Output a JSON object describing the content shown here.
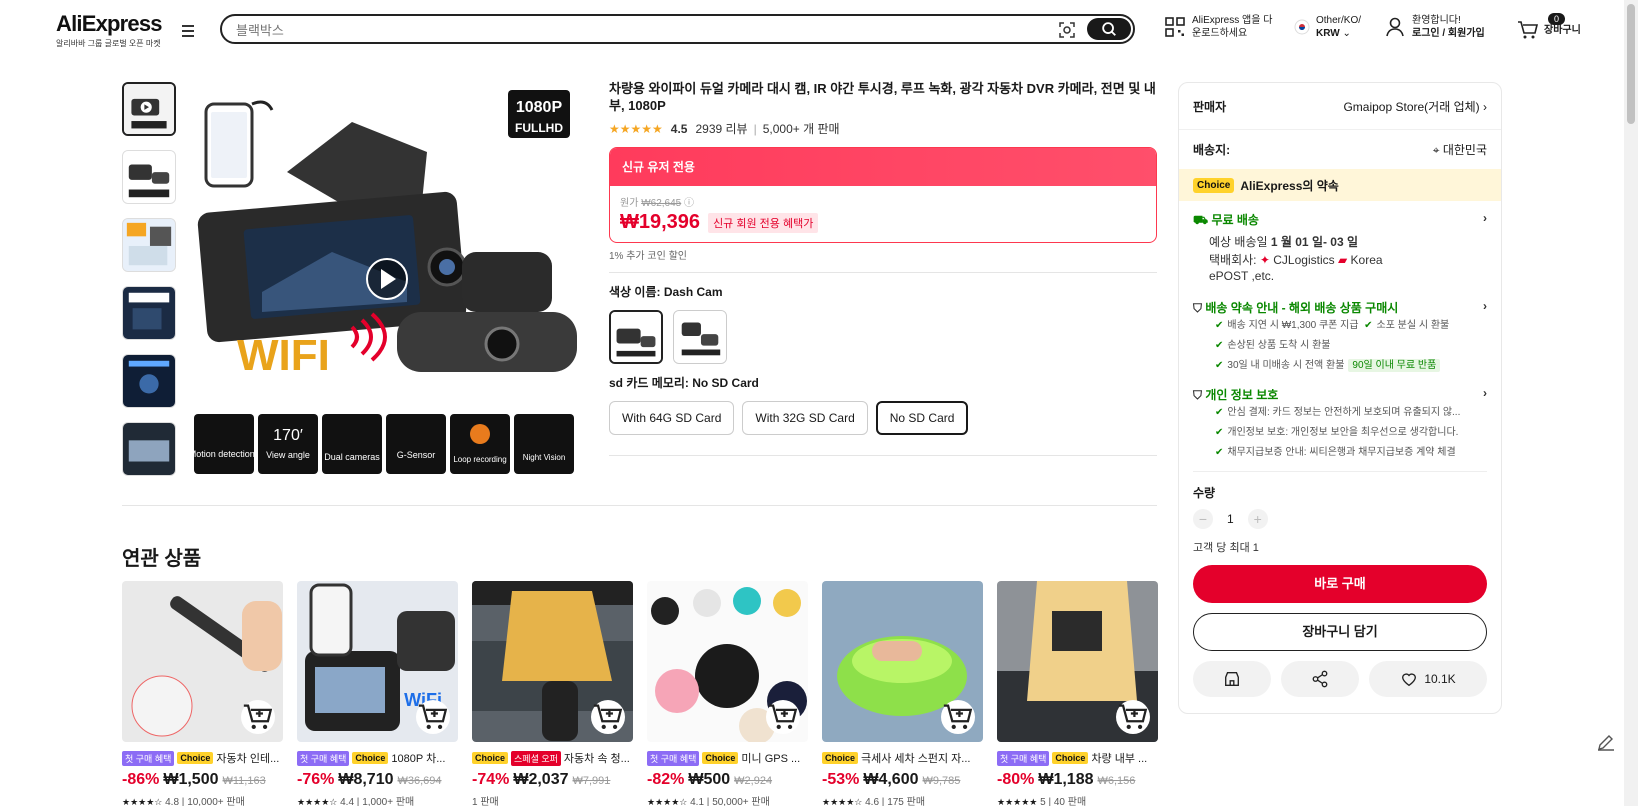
{
  "header": {
    "logo": "AliExpress",
    "logo_sub": "알리바바 그룹 글로벌 오픈 마켓",
    "search_placeholder": "블랙박스",
    "app_line1": "AliExpress 앱을 다",
    "app_line2": "운로드하세요",
    "region_line1": "Other/KO/",
    "region_line2": "KRW",
    "account_line1": "환영합니다!",
    "account_line2": "로그인 / 회원가입",
    "cart_count": "0",
    "cart_label": "장바구니"
  },
  "product": {
    "title": "차량용 와이파이 듀얼 카메라 대시 캠, IR 야간 투시경, 루프 녹화, 광각 자동차 DVR 카메라, 전면 및 내부, 1080P",
    "rating": "4.5",
    "reviews": "2939 리뷰",
    "sold": "5,000+ 개 판매",
    "promo_header": "신규 유저 전용",
    "orig_label": "원가",
    "orig_price": "₩62,645",
    "price": "₩19,396",
    "price_tag": "신규 회원 전용 혜택가",
    "coin_note": "1% 추가 코인 할인",
    "color_label": "색상 이름: Dash Cam",
    "sd_label": "sd 카드 메모리: No SD Card",
    "sd_options": [
      "With 64G SD Card",
      "With 32G SD Card",
      "No SD Card"
    ],
    "image_badge_top": "1080P",
    "image_badge_bottom": "FULLHD",
    "image_wifi": "WIFI",
    "features": [
      "Motion detections",
      "View angle",
      "Dual cameras",
      "G-Sensor",
      "Loop recording",
      "Night Vision"
    ],
    "feature_angle": "170′"
  },
  "panel": {
    "seller_label": "판매자",
    "seller_name": "Gmaipop Store(거래 업체)",
    "ship_to_label": "배송지:",
    "ship_to": "대한민국",
    "choice_chip": "Choice",
    "choice_text": "AliExpress의 약속",
    "free_ship": "무료 배송",
    "eta_prefix": "예상 배송일 ",
    "eta": "1 월 01 일- 03 일",
    "carrier_label": "택배회사: ",
    "carrier1": "CJLogistics",
    "carrier2": "Korea",
    "carrier3": "ePOST ,etc.",
    "promise_title": "배송 약속 안내 - 해외 배송 상품 구매시",
    "promise_items": [
      "배송 지연 시 ₩1,300 쿠폰 지급",
      "소포 분실 시 환불",
      "손상된 상품 도착 시 환불",
      "30일 내 미배송 시 전액 환불"
    ],
    "promise_chip": "90일 이내 무료 반품",
    "privacy_title": "개인 정보 보호",
    "privacy_items": [
      "안심 결제: 카드 정보는 안전하게 보호되며 유출되지 않...",
      "개인정보 보호: 개인정보 보안을 최우선으로 생각합니다.",
      "채무지급보증 안내: 씨티은행과 채무지급보증 계약 체결"
    ],
    "qty_label": "수량",
    "qty": "1",
    "qty_limit": "고객 당 최대 1",
    "buy_now": "바로 구매",
    "add_cart": "장바구니 담기",
    "wish_count": "10.1K"
  },
  "related": {
    "title": "연관 상품",
    "items": [
      {
        "tags": [
          "첫 구매 혜택",
          "Choice"
        ],
        "name": "자동차 인테...",
        "disc": "-86%",
        "price": "₩1,500",
        "old": "₩11,163",
        "stars": "★★★★☆",
        "rating": "4.8",
        "sold": "10,000+ 판매"
      },
      {
        "tags": [
          "첫 구매 혜택",
          "Choice"
        ],
        "name": "1080P 차...",
        "disc": "-76%",
        "price": "₩8,710",
        "old": "₩36,694",
        "stars": "★★★★☆",
        "rating": "4.4",
        "sold": "1,000+ 판매"
      },
      {
        "tags": [
          "Choice",
          "스페셜 오퍼"
        ],
        "name": "자동차 속 청...",
        "disc": "-74%",
        "price": "₩2,037",
        "old": "₩7,991",
        "stars": "",
        "rating": "",
        "sold": "1 판매"
      },
      {
        "tags": [
          "첫 구매 혜택",
          "Choice"
        ],
        "name": "미니 GPS ...",
        "disc": "-82%",
        "price": "₩500",
        "old": "₩2,924",
        "stars": "★★★★☆",
        "rating": "4.1",
        "sold": "50,000+ 판매"
      },
      {
        "tags": [
          "Choice"
        ],
        "name": "극세사 세차 스펀지 자...",
        "disc": "-53%",
        "price": "₩4,600",
        "old": "₩9,785",
        "stars": "★★★★☆",
        "rating": "4.6",
        "sold": "175 판매"
      },
      {
        "tags": [
          "첫 구매 혜택",
          "Choice"
        ],
        "name": "차량 내부 ...",
        "disc": "-80%",
        "price": "₩1,188",
        "old": "₩6,156",
        "stars": "★★★★★",
        "rating": "5",
        "sold": "40 판매"
      }
    ]
  },
  "colors": {
    "accent": "#e4002b",
    "choice": "#ffd22b",
    "promo": "#ff3b5c",
    "green": "#0a8800"
  }
}
